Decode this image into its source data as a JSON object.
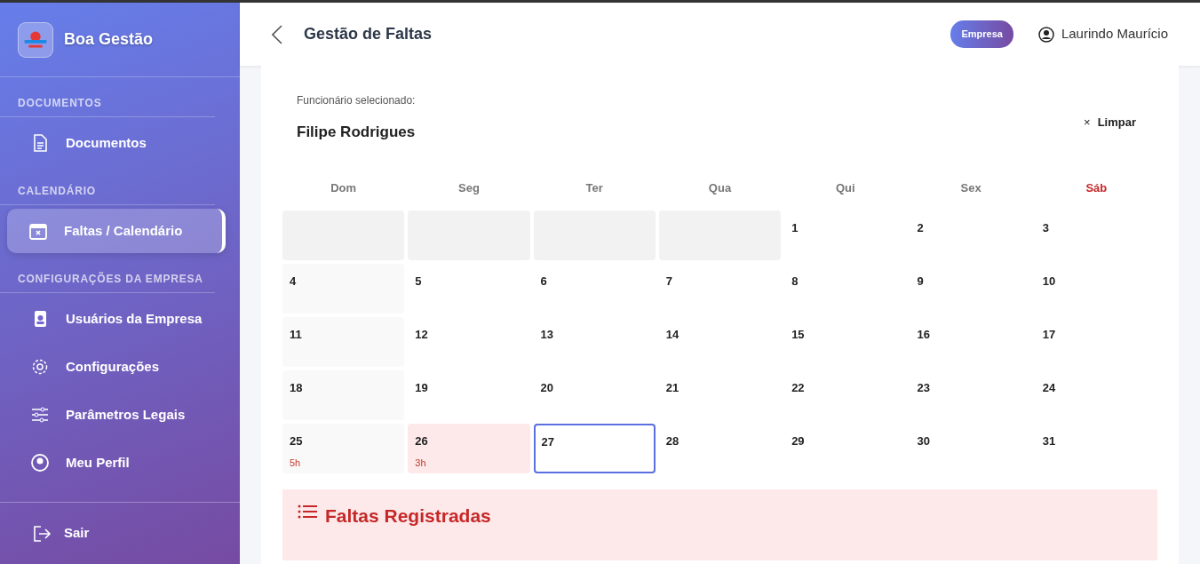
{
  "sidebar": {
    "brand": "Boa Gestão",
    "sections": [
      {
        "title": "DOCUMENTOS",
        "items": [
          {
            "label": "Documentos",
            "selected": false
          }
        ]
      },
      {
        "title": "CALENDÁRIO",
        "items": [
          {
            "label": "Faltas / Calendário",
            "selected": true
          }
        ]
      },
      {
        "title": "CONFIGURAÇÕES DA EMPRESA",
        "items": [
          {
            "label": "Usuários da Empresa",
            "selected": false
          },
          {
            "label": "Configurações",
            "selected": false
          },
          {
            "label": "Parâmetros Legais",
            "selected": false
          },
          {
            "label": "Meu Perfil",
            "selected": false
          }
        ]
      }
    ],
    "logout": "Sair"
  },
  "header": {
    "title": "Gestão de Faltas",
    "role_badge": "Empresa",
    "user": "Laurindo Maurício"
  },
  "employee": {
    "label": "Funcionário selecionado:",
    "name": "Filipe Rodrigues",
    "clear": "Limpar",
    "clear_icon": "×"
  },
  "calendar": {
    "weekdays": [
      {
        "label": "Dom",
        "weekend": false
      },
      {
        "label": "Seg",
        "weekend": false
      },
      {
        "label": "Ter",
        "weekend": false
      },
      {
        "label": "Qua",
        "weekend": false
      },
      {
        "label": "Qui",
        "weekend": false
      },
      {
        "label": "Sex",
        "weekend": false
      },
      {
        "label": "Sáb",
        "weekend": true
      }
    ],
    "weeks": [
      [
        {
          "kind": "empty"
        },
        {
          "kind": "empty"
        },
        {
          "kind": "empty"
        },
        {
          "kind": "empty"
        },
        {
          "kind": "day",
          "day": "1"
        },
        {
          "kind": "day",
          "day": "2"
        },
        {
          "kind": "day",
          "day": "3"
        }
      ],
      [
        {
          "kind": "sunday",
          "day": "4"
        },
        {
          "kind": "day",
          "day": "5"
        },
        {
          "kind": "day",
          "day": "6"
        },
        {
          "kind": "day",
          "day": "7"
        },
        {
          "kind": "day",
          "day": "8"
        },
        {
          "kind": "day",
          "day": "9"
        },
        {
          "kind": "day",
          "day": "10"
        }
      ],
      [
        {
          "kind": "sunday",
          "day": "11"
        },
        {
          "kind": "day",
          "day": "12"
        },
        {
          "kind": "day",
          "day": "13"
        },
        {
          "kind": "day",
          "day": "14"
        },
        {
          "kind": "day",
          "day": "15"
        },
        {
          "kind": "day",
          "day": "16"
        },
        {
          "kind": "day",
          "day": "17"
        }
      ],
      [
        {
          "kind": "sunday",
          "day": "18"
        },
        {
          "kind": "day",
          "day": "19"
        },
        {
          "kind": "day",
          "day": "20"
        },
        {
          "kind": "day",
          "day": "21"
        },
        {
          "kind": "day",
          "day": "22"
        },
        {
          "kind": "day",
          "day": "23"
        },
        {
          "kind": "day",
          "day": "24"
        }
      ],
      [
        {
          "kind": "sunday",
          "day": "25",
          "hours": "5h"
        },
        {
          "kind": "absence",
          "day": "26",
          "hours": "3h"
        },
        {
          "kind": "today",
          "day": "27"
        },
        {
          "kind": "day",
          "day": "28"
        },
        {
          "kind": "day",
          "day": "29"
        },
        {
          "kind": "day",
          "day": "30"
        },
        {
          "kind": "day",
          "day": "31"
        }
      ]
    ]
  },
  "absences_panel": {
    "title": "Faltas Registradas"
  }
}
